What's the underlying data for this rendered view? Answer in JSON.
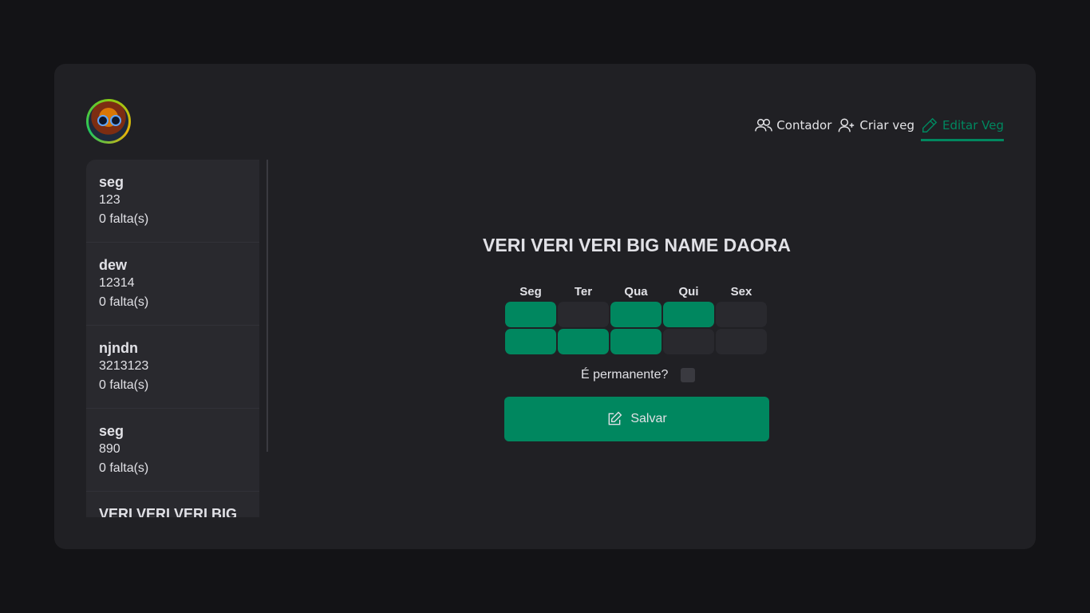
{
  "nav": {
    "items": [
      {
        "label": "Contador",
        "icon": "users-icon"
      },
      {
        "label": "Criar veg",
        "icon": "user-plus-icon"
      },
      {
        "label": "Editar Veg",
        "icon": "pencil-icon",
        "active": true
      }
    ]
  },
  "sidebar": {
    "items": [
      {
        "name": "seg",
        "code": "123",
        "faltas": "0 falta(s)"
      },
      {
        "name": "dew",
        "code": "12314",
        "faltas": "0 falta(s)"
      },
      {
        "name": "njndn",
        "code": "3213123",
        "faltas": "0 falta(s)"
      },
      {
        "name": "seg",
        "code": "890",
        "faltas": "0 falta(s)"
      },
      {
        "name": "VERI VERI VERI BIG",
        "code": "",
        "faltas": ""
      }
    ]
  },
  "editor": {
    "title": "VERI VERI VERI BIG NAME DAORA",
    "days": [
      "Seg",
      "Ter",
      "Qua",
      "Qui",
      "Sex"
    ],
    "schedule": [
      [
        true,
        false,
        true,
        true,
        false
      ],
      [
        true,
        true,
        true,
        false,
        false
      ]
    ],
    "permanent_label": "É permanente?",
    "permanent": false,
    "save_label": "Salvar"
  },
  "colors": {
    "accent": "#00875f",
    "card": "#202024",
    "background": "#131316"
  }
}
